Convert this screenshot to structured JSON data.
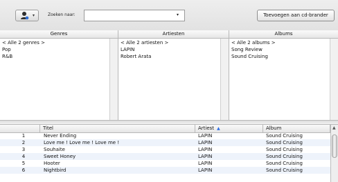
{
  "toolbar": {
    "action_icon": "person-icon",
    "action_caret": "▾",
    "search_label": "Zoeken naar:",
    "search_value": "",
    "search_arrow": "▾",
    "add_cd_label": "Toevoegen aan cd-brander"
  },
  "browser": {
    "headers": {
      "genres": "Genres",
      "artists": "Artiesten",
      "albums": "Albums"
    },
    "genres": [
      "< Alle 2 genres >",
      "Pop",
      "R&B"
    ],
    "artists": [
      "< Alle 2 artiesten >",
      "LAPIN",
      "Robert Arata"
    ],
    "albums": [
      "< Alle 2 albums >",
      "Song Review",
      "Sound Cruising"
    ]
  },
  "tracks": {
    "headers": {
      "title": "Titel",
      "artist": "Artiest",
      "album": "Album"
    },
    "sort_indicator": "▲",
    "rows": [
      {
        "num": "1",
        "title": "Never Ending",
        "artist": "LAPIN",
        "album": "Sound Cruising"
      },
      {
        "num": "2",
        "title": "Love me ! Love me ! Love me !",
        "artist": "LAPIN",
        "album": "Sound Cruising"
      },
      {
        "num": "3",
        "title": "Souhaite",
        "artist": "LAPIN",
        "album": "Sound Cruising"
      },
      {
        "num": "4",
        "title": "Sweet Honey",
        "artist": "LAPIN",
        "album": "Sound Cruising"
      },
      {
        "num": "5",
        "title": "Hooter",
        "artist": "LAPIN",
        "album": "Sound Cruising"
      },
      {
        "num": "6",
        "title": "Nightbird",
        "artist": "LAPIN",
        "album": "Sound Cruising"
      }
    ]
  },
  "scrollbar": {
    "up_arrow": "▲"
  },
  "colors": {
    "alt_row": "#eef3fb",
    "sort_arrow": "#2d6de4"
  }
}
